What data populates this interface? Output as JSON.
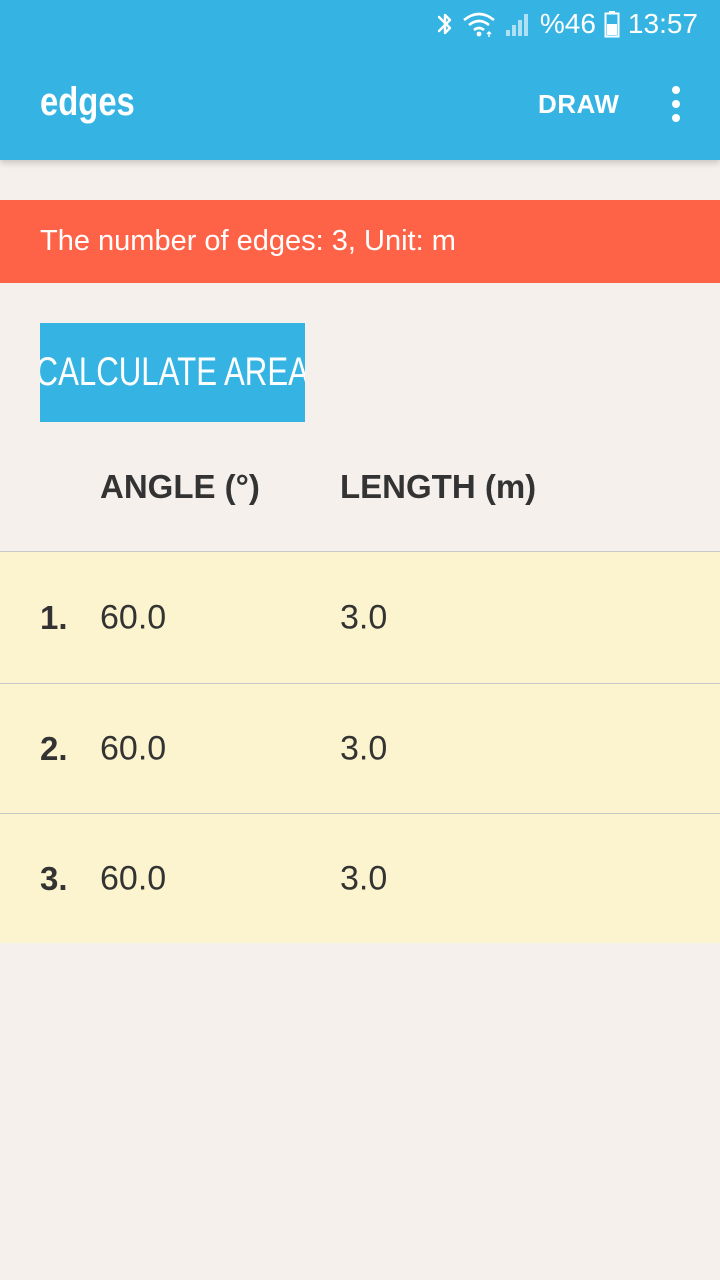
{
  "status_bar": {
    "battery_text": "%46",
    "time": "13:57",
    "icons": [
      "bluetooth-icon",
      "wifi-icon",
      "signal-icon",
      "battery-icon"
    ]
  },
  "app_bar": {
    "title": "edges",
    "draw_label": "DRAW",
    "overflow_icon": "more-vert-icon"
  },
  "info_banner": {
    "text": "The number of edges: 3, Unit: m"
  },
  "calculate_button": {
    "label": "CALCULATE AREA"
  },
  "table": {
    "headers": {
      "angle": "ANGLE (°)",
      "length": "LENGTH (m)"
    },
    "rows": [
      {
        "index": "1.",
        "angle": "60.0",
        "length": "3.0"
      },
      {
        "index": "2.",
        "angle": "60.0",
        "length": "3.0"
      },
      {
        "index": "3.",
        "angle": "60.0",
        "length": "3.0"
      }
    ]
  },
  "colors": {
    "primary": "#35B4E4",
    "banner": "#FF6347",
    "row_background": "#FCF4CE",
    "page_background": "#F5F0EC"
  }
}
